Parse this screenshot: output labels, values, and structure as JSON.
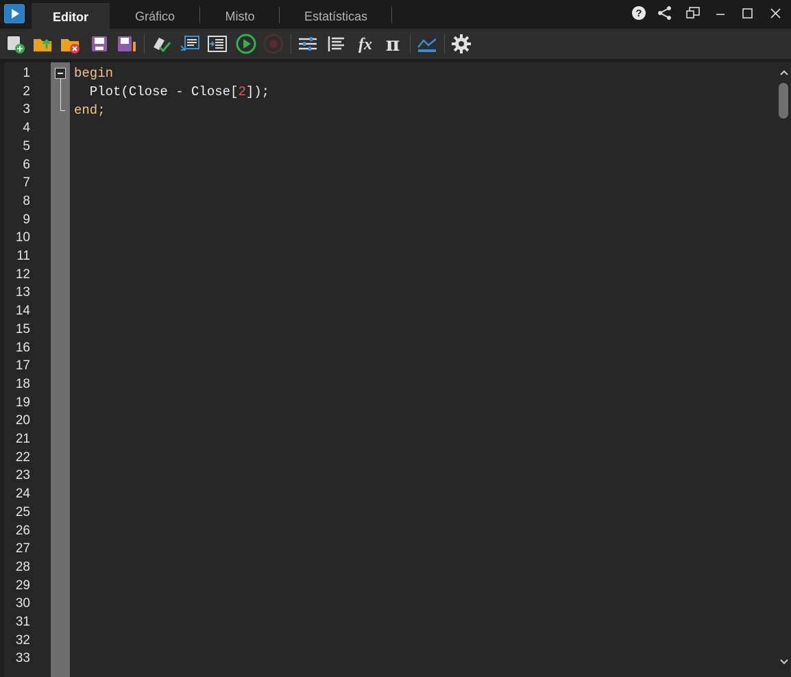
{
  "window": {
    "tabs": [
      {
        "label": "Editor",
        "active": true
      },
      {
        "label": "Gráfico",
        "active": false
      },
      {
        "label": "Misto",
        "active": false
      },
      {
        "label": "Estatísticas",
        "active": false
      }
    ],
    "controls": [
      "help-icon",
      "share-icon",
      "undock-icon",
      "minimize-icon",
      "maximize-icon",
      "close-icon"
    ]
  },
  "toolbar": {
    "buttons": [
      "new-strategy-icon",
      "open-file-icon",
      "delete-file-icon",
      "save-icon",
      "save-as-icon",
      "compile-icon",
      "insert-indicator-icon",
      "insert-function-icon",
      "run-icon",
      "stop-icon",
      "parameters-icon",
      "indent-icon",
      "function-fx-icon",
      "pi-constant-icon",
      "plot-chart-icon",
      "settings-icon"
    ]
  },
  "editor": {
    "line_numbers": [
      "1",
      "2",
      "3",
      "4",
      "5",
      "6",
      "7",
      "8",
      "9",
      "10",
      "11",
      "12",
      "13",
      "14",
      "15",
      "16",
      "17",
      "18",
      "19",
      "20",
      "21",
      "22",
      "23",
      "24",
      "25",
      "26",
      "27",
      "28",
      "29",
      "30",
      "31",
      "32",
      "33"
    ],
    "code": {
      "line1_kw": "begin",
      "line2_a": "  Plot(Close - Close[",
      "line2_num": "2",
      "line2_b": "]);",
      "line3_kw": "end;"
    }
  },
  "colors": {
    "keyword": "#f2c489",
    "number": "#e05a5a",
    "text": "#f0f0f0",
    "accent": "#3a8fd0",
    "run_green": "#2fb34a"
  }
}
